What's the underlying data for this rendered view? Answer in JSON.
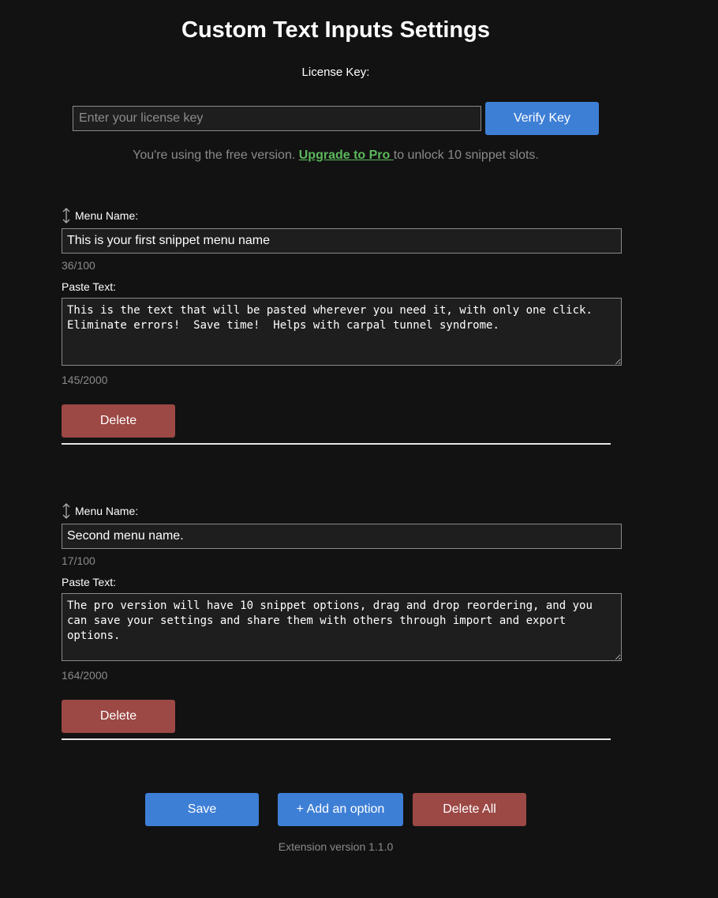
{
  "header": {
    "title": "Custom Text Inputs Settings"
  },
  "license": {
    "label": "License Key:",
    "placeholder": "Enter your license key",
    "value": "",
    "verify_label": "Verify Key"
  },
  "notice": {
    "before": "You're using the free version. ",
    "link_text": "Upgrade to Pro ",
    "after": "to unlock 10 snippet slots."
  },
  "snippets": [
    {
      "menu_label": "Menu Name:",
      "name_value": "This is your first snippet menu name",
      "name_count": "36/100",
      "paste_label": "Paste Text:",
      "paste_value": "This is the text that will be pasted wherever you need it, with only one click.  Eliminate errors!  Save time!  Helps with carpal tunnel syndrome.",
      "paste_count": "145/2000",
      "delete_label": "Delete"
    },
    {
      "menu_label": "Menu Name:",
      "name_value": "Second menu name.",
      "name_count": "17/100",
      "paste_label": "Paste Text:",
      "paste_value": "The pro version will have 10 snippet options, drag and drop reordering, and you can save your settings and share them with others through import and export options.",
      "paste_count": "164/2000",
      "delete_label": "Delete"
    }
  ],
  "footer": {
    "save_label": "Save",
    "add_label": "+ Add an option",
    "delete_all_label": "Delete All",
    "version": "Extension version 1.1.0"
  },
  "icons": {
    "drag": "drag-handle-icon"
  },
  "colors": {
    "background": "#121212",
    "primary_button": "#3e7fd6",
    "danger_button": "#9c4845",
    "link": "#5cb85c",
    "muted_text": "#8a8a8a"
  }
}
